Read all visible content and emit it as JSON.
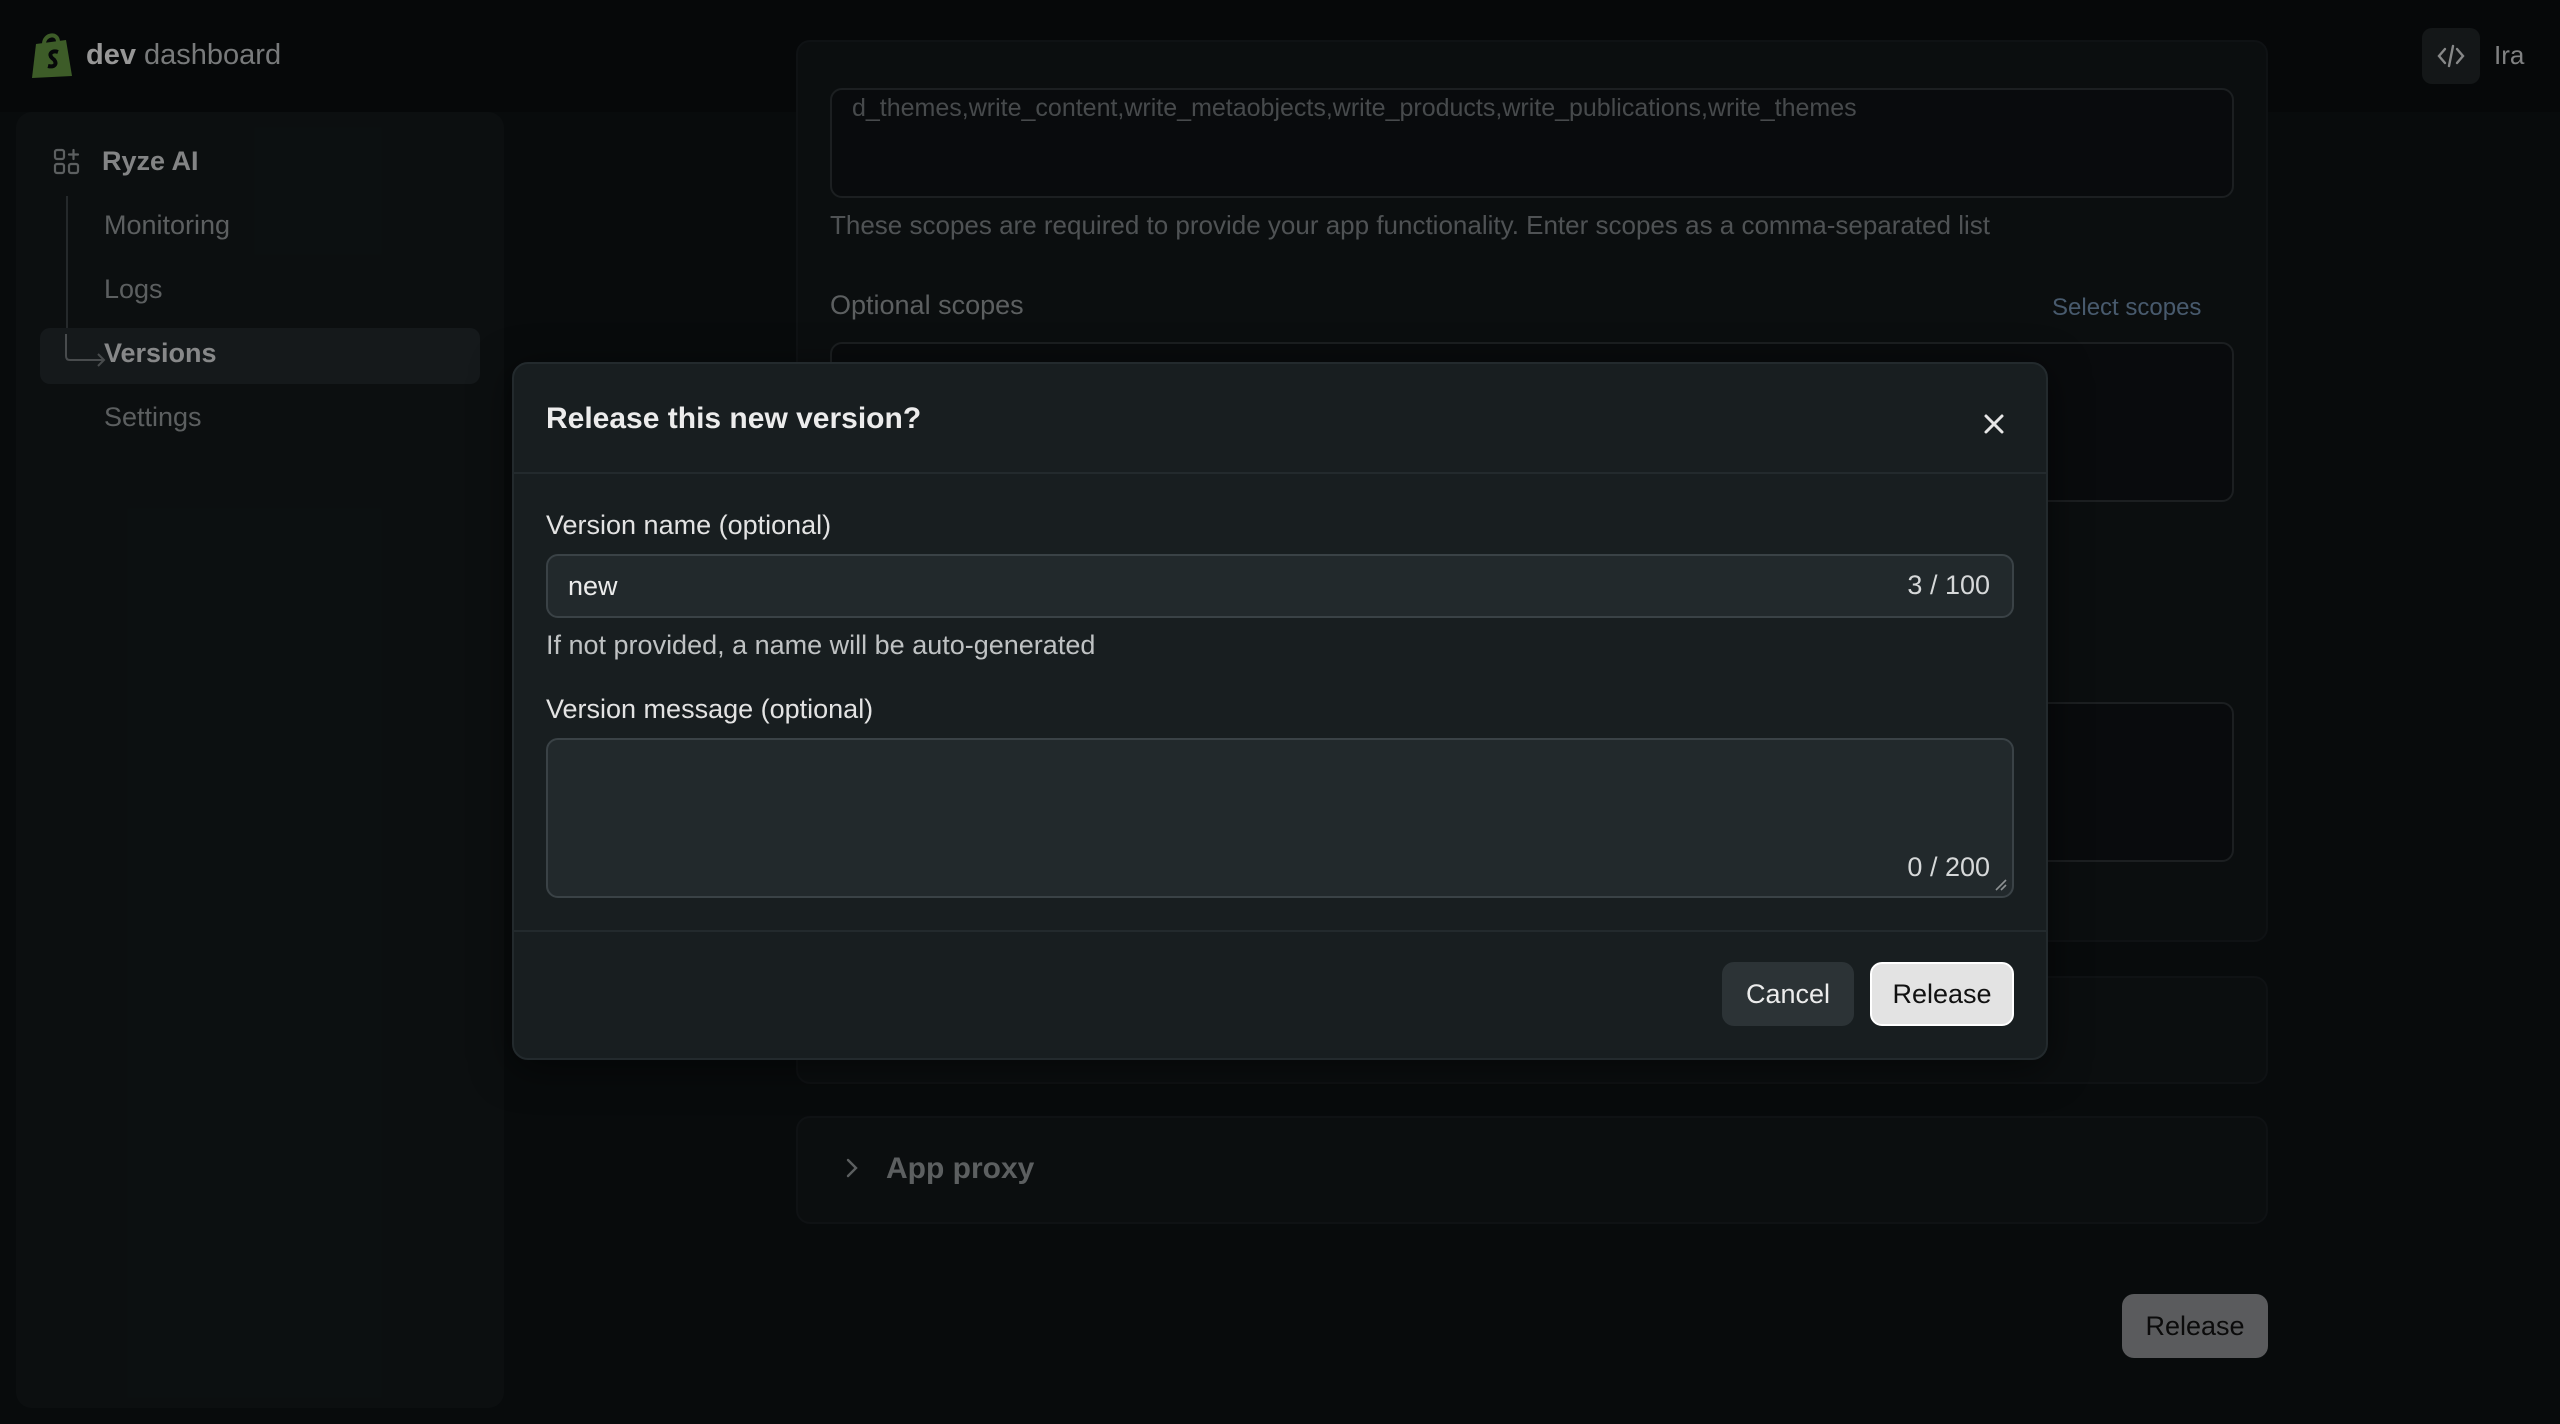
{
  "brand": {
    "bold": "dev",
    "rest": " dashboard",
    "logo_icon": "shopify-bag-icon",
    "accent": "#5e8e3e"
  },
  "topbar": {
    "dev_toggle_icon": "code-icon",
    "user": "Ira"
  },
  "sidebar": {
    "app_name": "Ryze AI",
    "app_icon": "apps-grid-icon",
    "items": [
      {
        "label": "Monitoring"
      },
      {
        "label": "Logs"
      },
      {
        "label": "Versions",
        "active": true
      },
      {
        "label": "Settings"
      }
    ]
  },
  "main": {
    "scopes_value": "d_themes,write_content,write_metaobjects,write_products,write_publications,write_themes",
    "scopes_help": "These scopes are required to provide your app functionality. Enter scopes as a comma-separated list",
    "optional_scopes_label": "Optional scopes",
    "select_scopes_link": "Select scopes",
    "app_proxy_title": "App proxy",
    "release_button": "Release"
  },
  "modal": {
    "title": "Release this new version?",
    "close_icon": "close-icon",
    "version_name_label": "Version name (optional)",
    "version_name_value": "new",
    "version_name_counter": "3 / 100",
    "version_name_help": "If not provided, a name will be auto-generated",
    "version_message_label": "Version message (optional)",
    "version_message_value": "",
    "version_message_counter": "0 / 200",
    "cancel_label": "Cancel",
    "release_label": "Release"
  }
}
